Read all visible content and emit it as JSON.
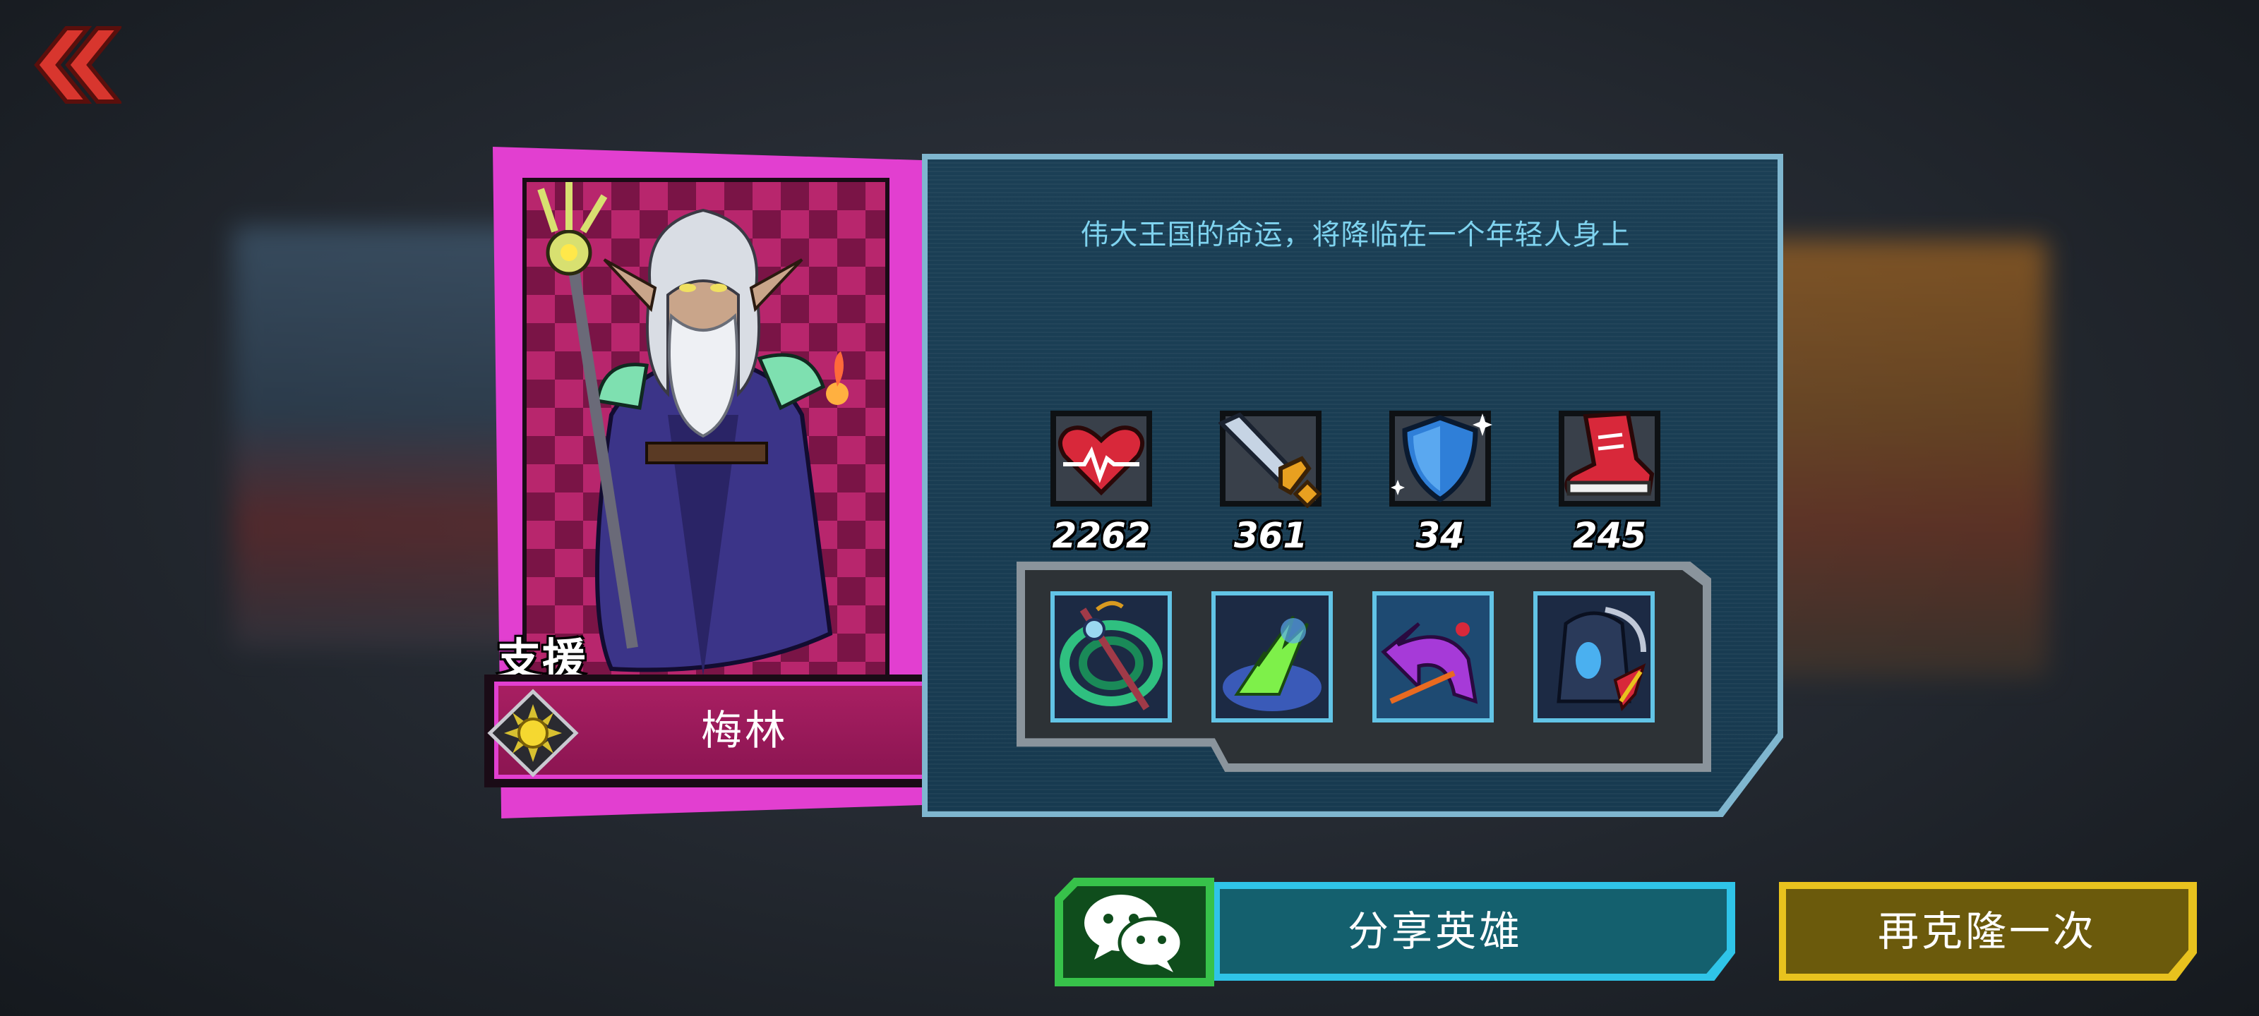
{
  "hero": {
    "name": "梅林",
    "role": "支援",
    "quote": "伟大王国的命运，将降临在一个年轻人身上",
    "card_color": "#e23fd0"
  },
  "stats": [
    {
      "icon": "heart-health-icon",
      "value": "2262"
    },
    {
      "icon": "sword-attack-icon",
      "value": "361"
    },
    {
      "icon": "shield-defense-icon",
      "value": "34"
    },
    {
      "icon": "sneaker-speed-icon",
      "value": "245"
    }
  ],
  "skills": [
    {
      "icon": "staff-vortex-skill-icon"
    },
    {
      "icon": "green-lightning-skill-icon"
    },
    {
      "icon": "purple-arrow-skill-icon"
    },
    {
      "icon": "reaper-ghost-skill-icon"
    }
  ],
  "buttons": {
    "back": "back-double-chevron-icon",
    "wechat": "wechat-icon",
    "share": "分享英雄",
    "clone_again": "再克隆一次"
  },
  "colors": {
    "panel_border": "#7fb6cf",
    "panel_bg": "#1b3f55",
    "quote_text": "#7fd3ef",
    "share_accent": "#2fc4e8",
    "clone_accent": "#e8c21e",
    "wechat_accent": "#37c24a"
  }
}
